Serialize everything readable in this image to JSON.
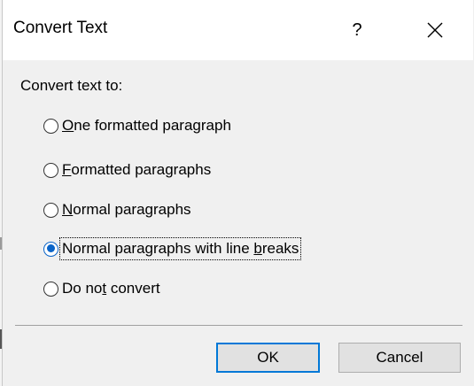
{
  "dialog": {
    "title": "Convert Text",
    "help_label": "?",
    "close_icon": "close-icon",
    "prompt": "Convert text to:"
  },
  "options": [
    {
      "pre": "",
      "key": "O",
      "post": "ne formatted paragraph",
      "checked": false
    },
    {
      "pre": "",
      "key": "F",
      "post": "ormatted paragraphs",
      "checked": false
    },
    {
      "pre": "",
      "key": "N",
      "post": "ormal paragraphs",
      "checked": false
    },
    {
      "pre": "Normal paragraphs with line ",
      "key": "b",
      "post": "reaks",
      "checked": true
    },
    {
      "pre": "Do no",
      "key": "t",
      "post": " convert",
      "checked": false
    }
  ],
  "buttons": {
    "ok_label": "OK",
    "cancel_label": "Cancel"
  },
  "colors": {
    "accent": "#0078d7",
    "radio_selected": "#0a64c8",
    "dialog_bg": "#f0f0f0"
  }
}
